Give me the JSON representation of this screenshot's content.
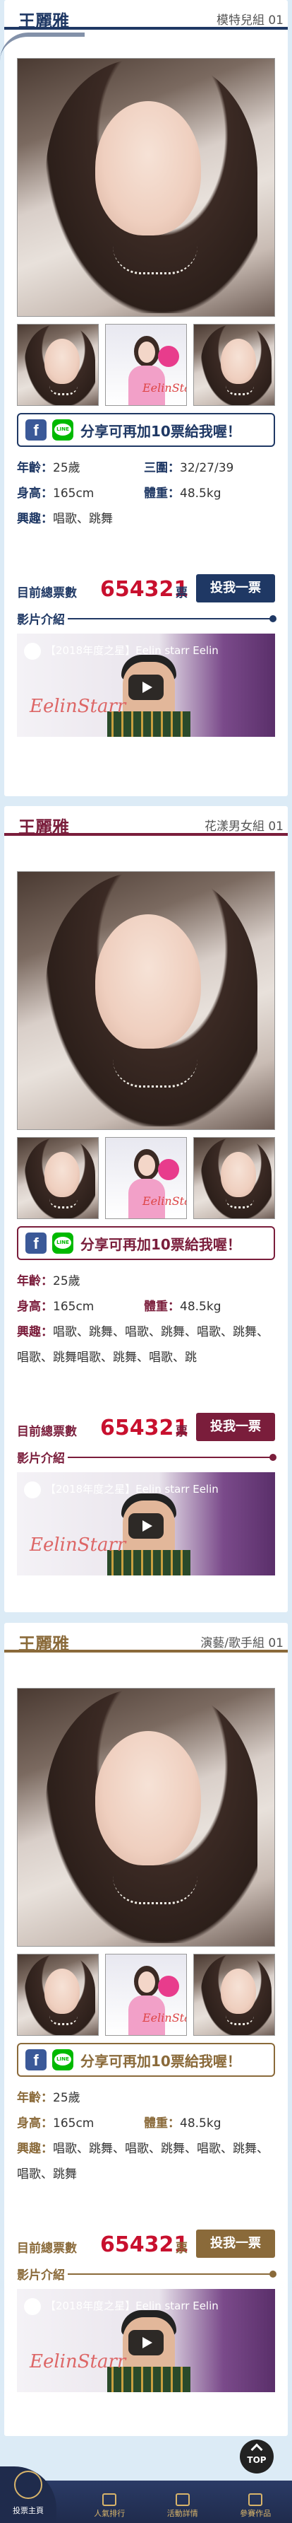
{
  "cards": [
    {
      "name": "王麗雅",
      "group": "模特兒組 01",
      "share_text": "分享可再加10票給我喔！",
      "age_label": "年齡：",
      "age": "25歲",
      "measure_label": "三圍：",
      "measure": "32/27/39",
      "height_label": "身高：",
      "height": "165cm",
      "weight_label": "體重：",
      "weight": "48.5kg",
      "hobby_label": "興趣：",
      "hobby": "唱歌、跳舞",
      "vote_label": "目前總票數",
      "votes": "654321",
      "vote_unit": "票",
      "vote_button": "投我一票",
      "video_label": "影片介紹",
      "video_title": "【2018年度之星】Eelin starr Eelin",
      "video_watermark": "EelinStarr"
    },
    {
      "name": "王麗雅",
      "group": "花漾男女組 01",
      "share_text": "分享可再加10票給我喔！",
      "age_label": "年齡：",
      "age": "25歲",
      "height_label": "身高：",
      "height": "165cm",
      "weight_label": "體重：",
      "weight": "48.5kg",
      "hobby_label": "興趣：",
      "hobby": "唱歌、跳舞、唱歌、跳舞、唱歌、跳舞、唱歌、跳舞唱歌、跳舞、唱歌、跳",
      "vote_label": "目前總票數",
      "votes": "654321",
      "vote_unit": "票",
      "vote_button": "投我一票",
      "video_label": "影片介紹",
      "video_title": "【2018年度之星】Eelin starr Eelin",
      "video_watermark": "EelinStarr"
    },
    {
      "name": "王麗雅",
      "group": "演藝/歌手組 01",
      "share_text": "分享可再加10票給我喔！",
      "age_label": "年齡：",
      "age": "25歲",
      "height_label": "身高：",
      "height": "165cm",
      "weight_label": "體重：",
      "weight": "48.5kg",
      "hobby_label": "興趣：",
      "hobby": "唱歌、跳舞、唱歌、跳舞、唱歌、跳舞、唱歌、跳舞",
      "vote_label": "目前總票數",
      "votes": "654321",
      "vote_unit": "票",
      "vote_button": "投我一票",
      "video_label": "影片介紹",
      "video_title": "【2018年度之星】Eelin starr Eelin",
      "video_watermark": "EelinStarr"
    }
  ],
  "thumb_badge": "EelinStar",
  "top_button": "TOP",
  "nav": {
    "logo_text": "投票主頁",
    "items": [
      {
        "label": "人氣排行",
        "icon": "crown-icon"
      },
      {
        "label": "活動詳情",
        "icon": "trophy-icon"
      },
      {
        "label": "參賽作品",
        "icon": "list-icon"
      }
    ]
  },
  "colors": {
    "card1": "#1f3864",
    "card2": "#7a1d3b",
    "card3": "#8a6a3a",
    "votes": "#c8102e",
    "background": "#dcebf6"
  }
}
